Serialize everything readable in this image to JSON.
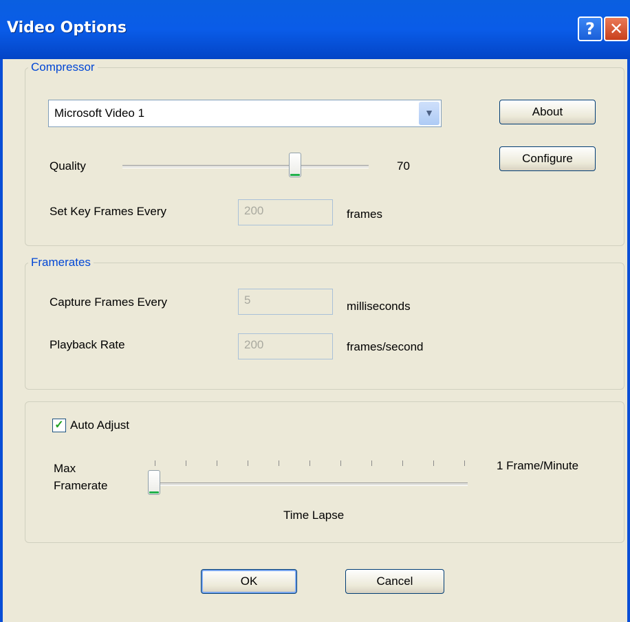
{
  "window": {
    "title": "Video Options",
    "help_glyph": "?",
    "close_glyph": "✕"
  },
  "compressor": {
    "legend": "Compressor",
    "codec": "Microsoft Video 1",
    "about_label": "About",
    "configure_label": "Configure",
    "quality_label": "Quality",
    "quality_value": "70",
    "quality_level": 0.7,
    "keyframes_label": "Set Key Frames Every",
    "keyframes_value": "200",
    "keyframes_unit": "frames"
  },
  "framerates": {
    "legend": "Framerates",
    "capture_label": "Capture Frames Every",
    "capture_value": "5",
    "capture_unit": "milliseconds",
    "playback_label": "Playback Rate",
    "playback_value": "200",
    "playback_unit": "frames/second"
  },
  "auto": {
    "checkbox_label": "Auto Adjust",
    "checked": true,
    "max_framerate_label_line1": "Max",
    "max_framerate_label_line2": "Framerate",
    "right_label": "1 Frame/Minute",
    "bottom_label": "Time Lapse",
    "slider_level": 0.0
  },
  "buttons": {
    "ok": "OK",
    "cancel": "Cancel"
  },
  "colors": {
    "title_bar": "#0a5ce8",
    "legend": "#0046d5",
    "face": "#ece9d8"
  }
}
